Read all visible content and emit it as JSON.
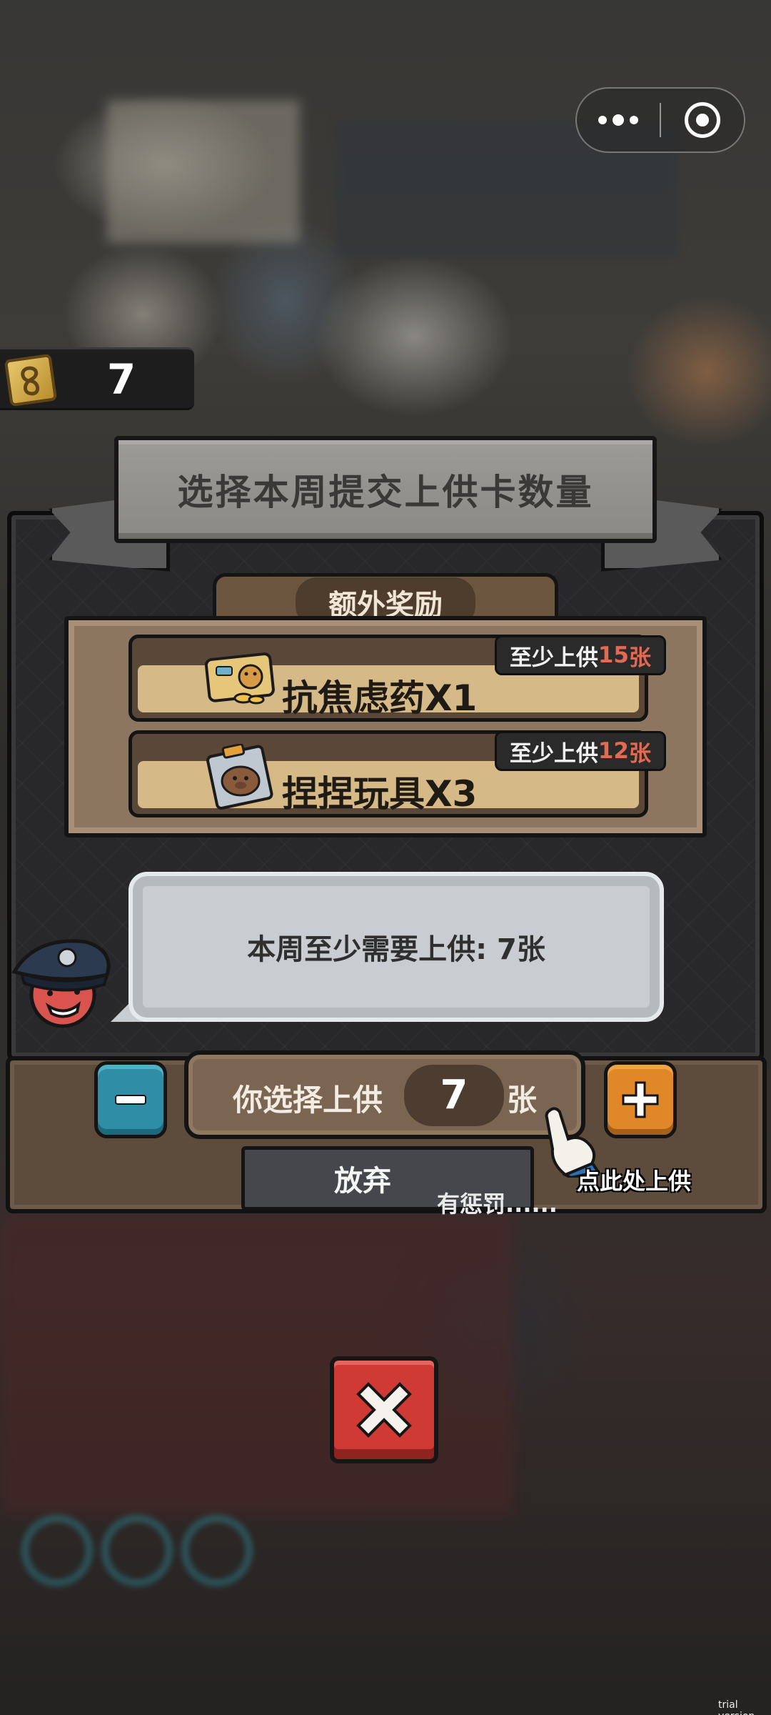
{
  "title": "选择本周提交上供卡数量",
  "currency": {
    "icon": "gold-card-icon",
    "count": "7"
  },
  "reward": {
    "tab_label": "额外奖励",
    "items": [
      {
        "icon": "anti-anxiety-pill-icon",
        "name": "抗焦虑药X1",
        "req_prefix": "至少上供",
        "req_num": "15",
        "req_unit": "张"
      },
      {
        "icon": "squeeze-toy-icon",
        "name": "捏捏玩具X3",
        "req_prefix": "至少上供",
        "req_num": "12",
        "req_unit": "张"
      }
    ]
  },
  "speech": {
    "text": "本周至少需要上供: 7张"
  },
  "selector": {
    "prefix": "你选择上供",
    "value": "7",
    "suffix": "张"
  },
  "actions": {
    "abandon": "放弃",
    "penalty": "有惩罚......",
    "tap_hint": "点此处上供"
  },
  "colors": {
    "minus_button": "#2f8ea6",
    "plus_button": "#e08728",
    "close_button": "#cf3a35",
    "req_number": "#e36a52"
  },
  "watermark": "trial version"
}
